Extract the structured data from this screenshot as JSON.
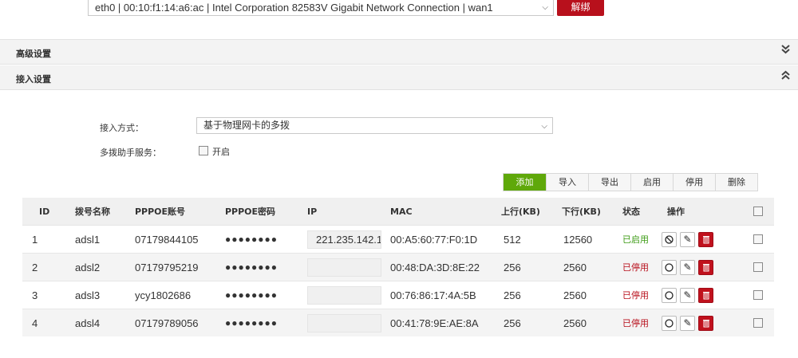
{
  "nic": {
    "selected": "eth0 | 00:10:f1:14:a6:ac | Intel Corporation 82583V Gigabit Network Connection | wan1",
    "unbind_label": "解绑"
  },
  "sections": {
    "advanced": {
      "title": "高级设置",
      "toggle_icon": "double-chevron-down"
    },
    "access": {
      "title": "接入设置",
      "toggle_icon": "double-chevron-up"
    }
  },
  "form": {
    "mode_label": "接入方式：",
    "mode_value": "基于物理网卡的多拨",
    "helper_label": "多拨助手服务：",
    "helper_option": "开启",
    "helper_checked": false
  },
  "toolbar": [
    "添加",
    "导入",
    "导出",
    "启用",
    "停用",
    "删除"
  ],
  "table": {
    "headers": [
      "ID",
      "拨号名称",
      "PPPOE账号",
      "PPPOE密码",
      "IP",
      "MAC",
      "上行(KB)",
      "下行(KB)",
      "状态",
      "操作"
    ],
    "rows": [
      {
        "id": "1",
        "name": "adsl1",
        "account": "07179844105",
        "password": "●●●●●●●●",
        "ip": "221.235.142.1",
        "mac": "00:A5:60:77:F0:1D",
        "up": "512",
        "down": "12560",
        "status": "已启用",
        "enabled": true
      },
      {
        "id": "2",
        "name": "adsl2",
        "account": "07179795219",
        "password": "●●●●●●●●",
        "ip": "",
        "mac": "00:48:DA:3D:8E:22",
        "up": "256",
        "down": "2560",
        "status": "已停用",
        "enabled": false
      },
      {
        "id": "3",
        "name": "adsl3",
        "account": "ycy1802686",
        "password": "●●●●●●●●",
        "ip": "",
        "mac": "00:76:86:17:4A:5B",
        "up": "256",
        "down": "2560",
        "status": "已停用",
        "enabled": false
      },
      {
        "id": "4",
        "name": "adsl4",
        "account": "07179789056",
        "password": "●●●●●●●●",
        "ip": "",
        "mac": "00:41:78:9E:AE:8A",
        "up": "256",
        "down": "2560",
        "status": "已停用",
        "enabled": false
      }
    ]
  },
  "colors": {
    "accent_green": "#5fa80a",
    "danger_red": "#b8101c",
    "enabled_text": "#3c9b14"
  }
}
